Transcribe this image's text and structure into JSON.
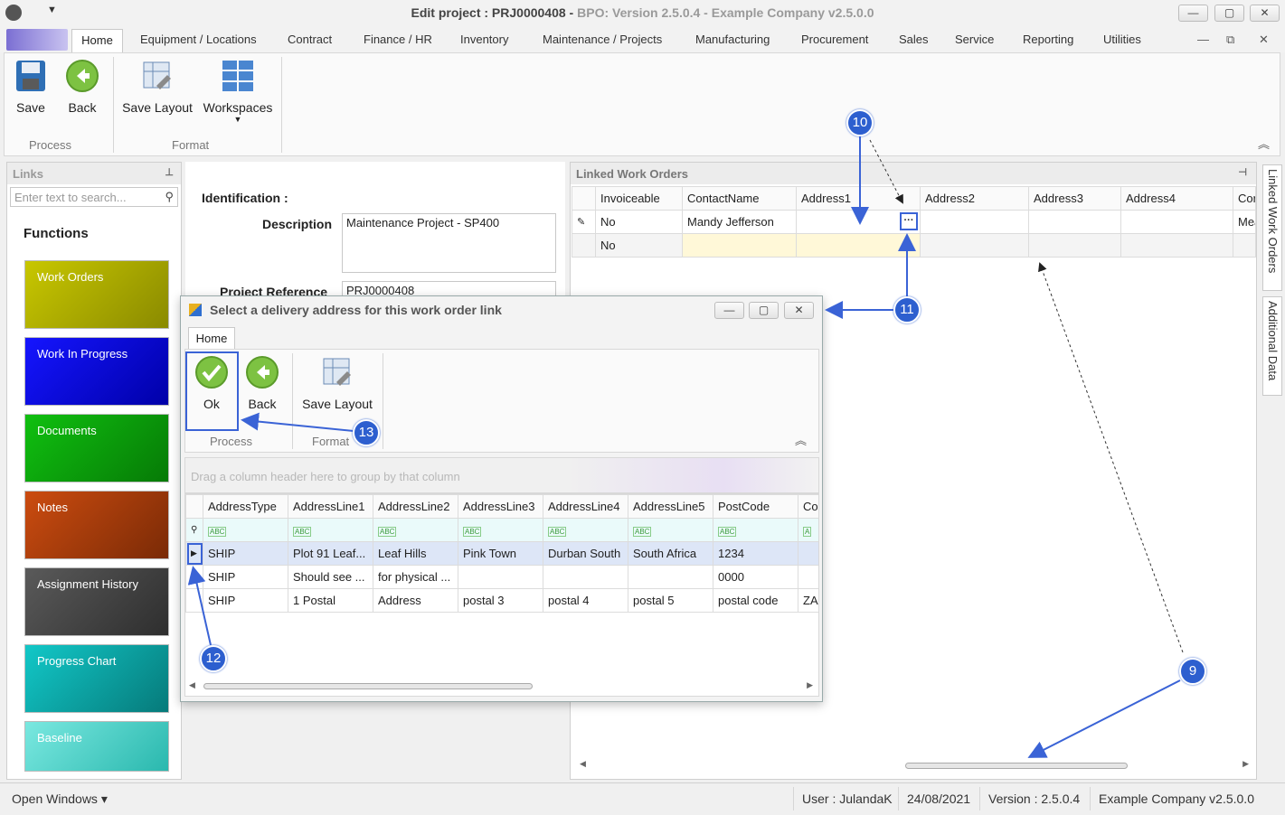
{
  "window": {
    "title_main": "Edit project : PRJ0000408",
    "title_dim": "BPO: Version 2.5.0.4 - Example Company v2.5.0.0",
    "min": "—",
    "max": "▢",
    "close": "✕"
  },
  "menu": {
    "tabs": [
      "Home",
      "Equipment / Locations",
      "Contract",
      "Finance / HR",
      "Inventory",
      "Maintenance / Projects",
      "Manufacturing",
      "Procurement",
      "Sales",
      "Service",
      "Reporting",
      "Utilities"
    ]
  },
  "ribbon": {
    "save": "Save",
    "back": "Back",
    "save_layout": "Save Layout",
    "workspaces": "Workspaces",
    "group_process": "Process",
    "group_format": "Format"
  },
  "links": {
    "title": "Links",
    "search_placeholder": "Enter text to search...",
    "functions": "Functions",
    "tiles": [
      {
        "label": "Work Orders",
        "color": "#b5b400"
      },
      {
        "label": "Work In Progress",
        "color": "#0a0ae6"
      },
      {
        "label": "Documents",
        "color": "#0aa80a"
      },
      {
        "label": "Notes",
        "color": "#b53f0a"
      },
      {
        "label": "Assignment History",
        "color": "#4a4a4a"
      },
      {
        "label": "Progress Chart",
        "color": "#0ab3b3"
      },
      {
        "label": "Baseline",
        "color": "#4fd9d0"
      }
    ]
  },
  "form": {
    "identification": "Identification :",
    "description_label": "Description",
    "description_value": "Maintenance Project - SP400",
    "project_ref_label": "Project Reference",
    "project_ref_value": "PRJ0000408"
  },
  "linked_work_orders": {
    "title": "Linked Work Orders",
    "columns": [
      "Invoiceable",
      "ContactName",
      "Address1",
      "Address2",
      "Address3",
      "Address4",
      "Cor"
    ],
    "rows": [
      [
        "No",
        "Mandy Jefferson",
        "",
        "",
        "",
        "",
        "Mea"
      ],
      [
        "No",
        "",
        "",
        "",
        "",
        "",
        ""
      ]
    ],
    "ellipsis": "···"
  },
  "side_tabs": [
    "Linked Work Orders",
    "Additional Data"
  ],
  "dialog": {
    "title": "Select a delivery address for this work order link",
    "tab": "Home",
    "ok": "Ok",
    "back": "Back",
    "save_layout": "Save Layout",
    "group_process": "Process",
    "group_format": "Format",
    "group_hint": "Drag a column header here to group by that column",
    "columns": [
      "AddressType",
      "AddressLine1",
      "AddressLine2",
      "AddressLine3",
      "AddressLine4",
      "AddressLine5",
      "PostCode",
      "Co"
    ],
    "rows": [
      [
        "SHIP",
        "Plot 91 Leaf...",
        "Leaf Hills",
        "Pink Town",
        "Durban South",
        "South Africa",
        "1234",
        ""
      ],
      [
        "SHIP",
        "Should see ...",
        "for physical ...",
        "",
        "",
        "",
        "0000",
        ""
      ],
      [
        "SHIP",
        "1 Postal",
        "Address",
        "postal 3",
        "postal 4",
        "postal 5",
        "postal code",
        "ZA"
      ]
    ]
  },
  "callouts": [
    "9",
    "10",
    "11",
    "12",
    "13"
  ],
  "status": {
    "open_windows": "Open Windows ▾",
    "user": "User : JulandaK",
    "date": "24/08/2021",
    "version": "Version : 2.5.0.4",
    "company": "Example Company v2.5.0.0"
  }
}
